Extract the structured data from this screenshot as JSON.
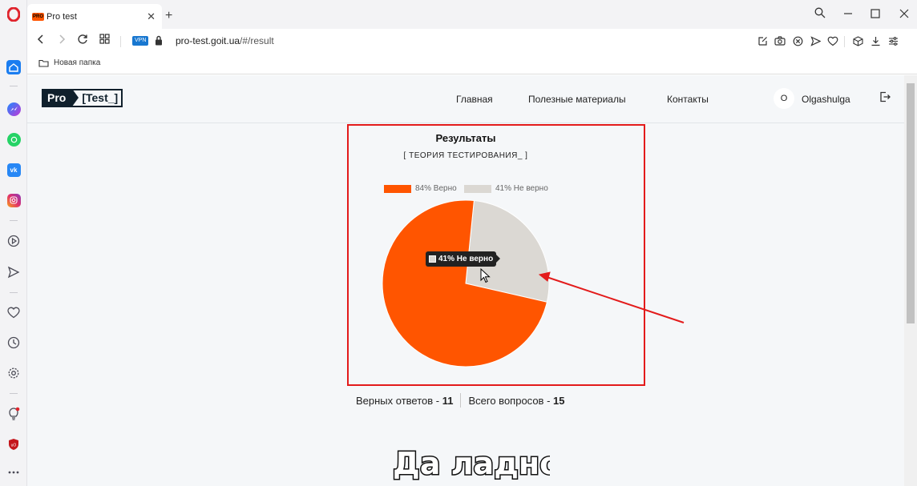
{
  "browser": {
    "tab_title": "Pro test",
    "tab_favicon_text": "PRO",
    "new_tab_symbol": "+",
    "vpn_badge": "VPN",
    "url_host": "pro-test.goit.ua",
    "url_path": "/#/result",
    "bookmark_folder": "Новая папка"
  },
  "site": {
    "logo_left": "Pro",
    "logo_right": "[Test_]",
    "nav": {
      "home": "Главная",
      "materials": "Полезные материалы",
      "contacts": "Контакты"
    },
    "user": {
      "avatar_letter": "O",
      "name": "Olgashulga"
    }
  },
  "results": {
    "title": "Результаты",
    "subtitle": "[ ТЕОРИЯ ТЕСТИРОВАНИЯ_ ]",
    "tooltip": "41% Не верно",
    "correct_label": "Верных ответов - ",
    "correct_value": "11",
    "total_label": "Всего вопросов - ",
    "total_value": "15"
  },
  "chart_data": {
    "type": "pie",
    "title": "",
    "categories": [
      "84% Верно",
      "41% Не верно"
    ],
    "values": [
      73,
      27
    ],
    "colors": [
      "#ff5500",
      "#dbd8d3"
    ],
    "legend_position": "top"
  },
  "sticker_text": "Да ладно",
  "colors": {
    "accent": "#ff5500",
    "secondary": "#dbd8d3",
    "annotation": "#e31b1b",
    "logo_dark": "#10202c"
  }
}
